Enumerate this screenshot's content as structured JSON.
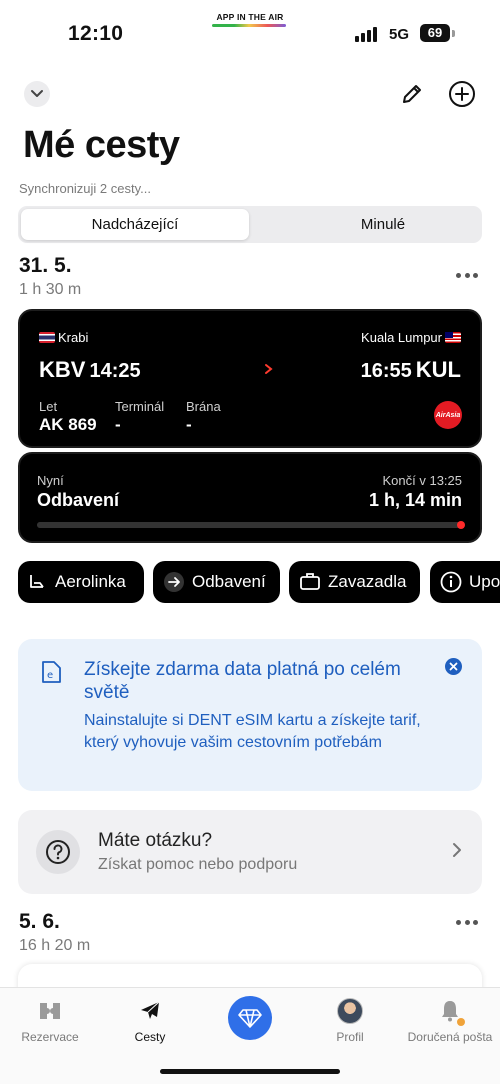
{
  "status_bar": {
    "time": "12:10",
    "app_banner": "APP IN THE AIR",
    "network": "5G",
    "battery": "69"
  },
  "toolbar": {
    "collapse_icon": "chevron-down-icon",
    "edit_icon": "pencil-icon",
    "add_icon": "plus-circle-icon"
  },
  "page": {
    "title": "Mé cesty",
    "sync_status": "Synchronizuji 2 cesty..."
  },
  "segments": {
    "upcoming": "Nadcházející",
    "past": "Minulé",
    "selected": "upcoming"
  },
  "trips": [
    {
      "date": "31. 5.",
      "duration": "1 h 30 m",
      "flight": {
        "from_city": "Krabi",
        "from_code": "KBV",
        "dep_time": "14:25",
        "to_city": "Kuala Lumpur",
        "to_code": "KUL",
        "arr_time": "16:55",
        "flight_label": "Let",
        "flight_number": "AK 869",
        "terminal_label": "Terminál",
        "terminal": "-",
        "gate_label": "Brána",
        "gate": "-",
        "airline_logo_text": "AirAsia"
      },
      "status": {
        "now_label": "Nyní",
        "phase": "Odbavení",
        "ends_label": "Končí v 13:25",
        "remaining": "1 h, 14 min",
        "progress": 1.0
      },
      "actions": [
        "Aerolinka",
        "Odbavení",
        "Zavazadla",
        "Upo"
      ]
    },
    {
      "date": "5. 6.",
      "duration": "16 h 20 m"
    }
  ],
  "esim_banner": {
    "title": "Získejte zdarma data platná po celém světě",
    "body": "Nainstalujte si DENT eSIM kartu a získejte tarif, který vyhovuje vašim cestovním potřebám",
    "accent": "#1f5fbf"
  },
  "help": {
    "title": "Máte otázku?",
    "subtitle": "Získat pomoc nebo podporu"
  },
  "tabbar": {
    "items": [
      {
        "label": "Rezervace",
        "icon": "tickets-icon"
      },
      {
        "label": "Cesty",
        "icon": "airplane-icon"
      },
      {
        "label": "",
        "icon": "diamond-icon"
      },
      {
        "label": "Profil",
        "icon": "avatar"
      },
      {
        "label": "Doručená pošta",
        "icon": "bell-icon"
      }
    ],
    "active": "Cesty",
    "accent": "#2f6fe8"
  }
}
